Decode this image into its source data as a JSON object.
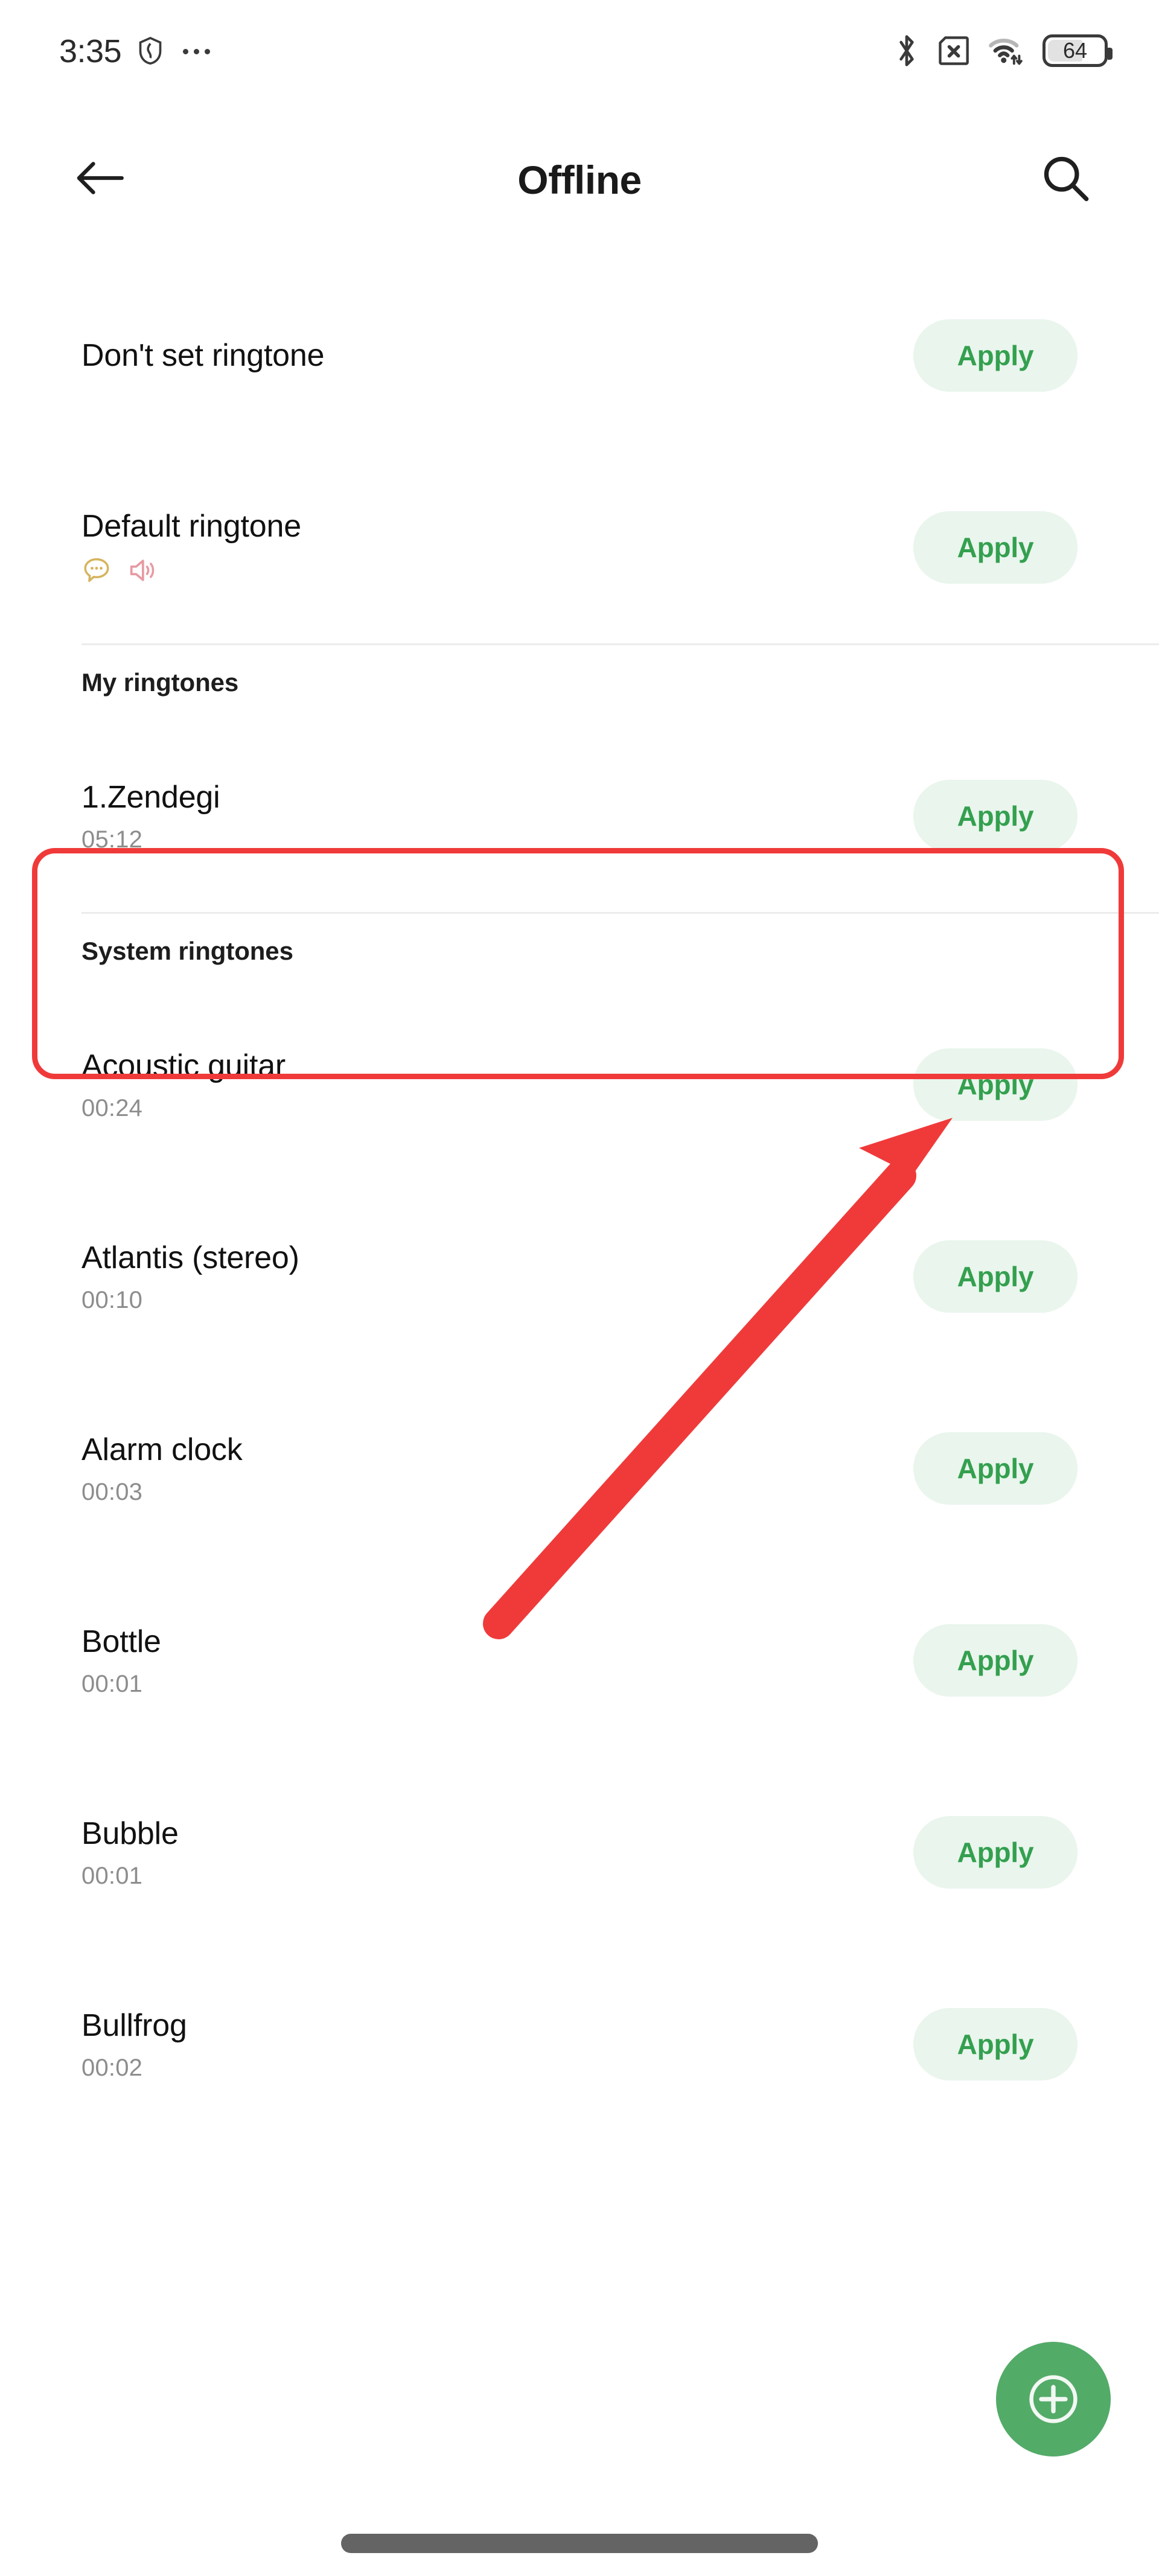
{
  "status_bar": {
    "time": "3:35",
    "battery_percent": "64",
    "icons": [
      "shield-icon",
      "more-dots-icon",
      "bluetooth-icon",
      "sim-card-off-icon",
      "wifi-icon",
      "battery-icon"
    ]
  },
  "app_bar": {
    "back_label": "back-arrow",
    "title": "Offline",
    "search_label": "search"
  },
  "apply_label": "Apply",
  "sections": [
    {
      "header": null,
      "rows": [
        {
          "title": "Don't set ringtone",
          "duration": null,
          "badges": [],
          "apply": "Apply",
          "highlighted": false
        },
        {
          "title": "Default ringtone",
          "duration": null,
          "badges": [
            "message-bubble-icon",
            "speaker-icon"
          ],
          "apply": "Apply",
          "highlighted": false
        }
      ]
    },
    {
      "header": "My ringtones",
      "rows": [
        {
          "title": "1.Zendegi",
          "duration": "05:12",
          "badges": [],
          "apply": "Apply",
          "highlighted": true
        }
      ]
    },
    {
      "header": "System ringtones",
      "rows": [
        {
          "title": "Acoustic guitar",
          "duration": "00:24",
          "badges": [],
          "apply": "Apply",
          "highlighted": false
        },
        {
          "title": "Atlantis (stereo)",
          "duration": "00:10",
          "badges": [],
          "apply": "Apply",
          "highlighted": false
        },
        {
          "title": "Alarm clock",
          "duration": "00:03",
          "badges": [],
          "apply": "Apply",
          "highlighted": false
        },
        {
          "title": "Bottle",
          "duration": "00:01",
          "badges": [],
          "apply": "Apply",
          "highlighted": false
        },
        {
          "title": "Bubble",
          "duration": "00:01",
          "badges": [],
          "apply": "Apply",
          "highlighted": false
        },
        {
          "title": "Bullfrog",
          "duration": "00:02",
          "badges": [],
          "apply": "Apply",
          "highlighted": false
        }
      ]
    }
  ],
  "fab": {
    "icon": "add-circle-icon"
  },
  "annotations": {
    "highlight_box_color": "#f03a3a",
    "arrow_color": "#f03a3a",
    "arrow_target": "1.Zendegi"
  },
  "colors": {
    "accent_green": "#34a04f",
    "apply_bg": "#e9f5ed",
    "fab_green": "#53ab68",
    "title_text": "#111111",
    "sub_text": "#8d8d8d",
    "badge_message": "#d6b45e",
    "badge_speaker": "#e79aa2"
  }
}
